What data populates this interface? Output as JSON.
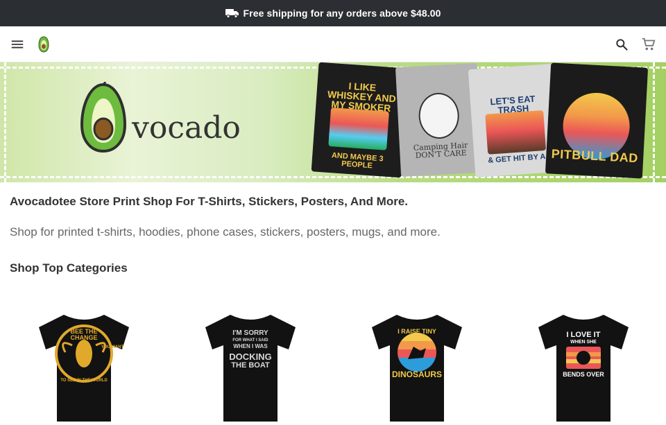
{
  "announcement": {
    "text": "Free shipping for any orders above $48.00",
    "icon": "truck-icon"
  },
  "header": {
    "menu_icon": "menu-icon",
    "logo": "avocado-logo-icon",
    "search_icon": "search-icon",
    "cart_icon": "cart-icon"
  },
  "banner": {
    "brand_text": "vocado",
    "shirts": [
      {
        "top": "I LIKE WHISKEY AND MY SMOKER",
        "bottom": "AND MAYBE 3 PEOPLE"
      },
      {
        "top": "",
        "bottom": "Camping Hair DON'T CARE"
      },
      {
        "top": "LET'S EAT TRASH",
        "bottom": "& GET HIT BY A"
      },
      {
        "top": "",
        "bottom": "PITBULL DAD"
      }
    ]
  },
  "store": {
    "title": "Avocadotee Store Print Shop For T-Shirts, Stickers, Posters, And More.",
    "description": "Shop for printed t-shirts, hoodies, phone cases, stickers, posters, mugs, and more."
  },
  "categories": {
    "heading": "Shop Top Categories",
    "items": [
      {
        "lines": [
          "BEE THE CHANGE",
          "YOU WANT",
          "TO SEE IN THE WORLD"
        ]
      },
      {
        "lines": [
          "I'M SORRY",
          "FOR WHAT I SAID",
          "WHEN I WAS",
          "DOCKING",
          "THE BOAT"
        ]
      },
      {
        "lines": [
          "I RAISE TINY",
          "DINOSAURS"
        ]
      },
      {
        "lines": [
          "I LOVE IT",
          "WHEN SHE",
          "BENDS OVER"
        ]
      }
    ]
  },
  "colors": {
    "topbar": "#2b2f33",
    "avocado_green": "#6dbb3f",
    "text": "#333333",
    "muted": "#666666"
  }
}
